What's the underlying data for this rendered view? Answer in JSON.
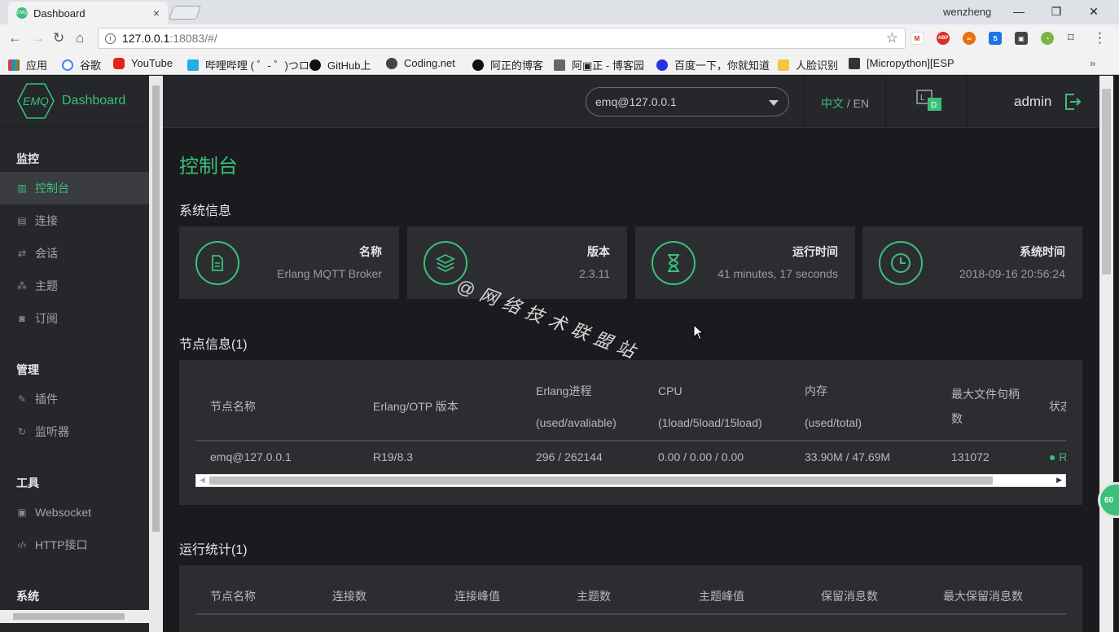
{
  "browser": {
    "tab_title": "Dashboard",
    "tab_favicon": "EMQ",
    "tab_close": "×",
    "user_name": "wenzheng",
    "window_controls": [
      "—",
      "❐",
      "✕"
    ],
    "url_host": "127.0.0.1",
    "url_path": ":18083/#/",
    "bookmarks": [
      "应用",
      "谷歌",
      "YouTube",
      "哔哩哔哩 ( ゜- ゜)つロ",
      "GitHub上",
      "Coding.net",
      "阿正的博客",
      "阿▣正 - 博客园",
      "百度一下，你就知道",
      "人脸识别",
      "[Micropython][ESP"
    ],
    "bookmarks_more": "»",
    "extensions": [
      "M",
      "ABP",
      "∞",
      "S",
      "▣",
      "◔"
    ]
  },
  "sidebar": {
    "logo_badge": "EMQ",
    "logo_text": "Dashboard",
    "sections": [
      {
        "title": "监控",
        "items": [
          "控制台",
          "连接",
          "会话",
          "主题",
          "订阅"
        ]
      },
      {
        "title": "管理",
        "items": [
          "插件",
          "监听器"
        ]
      },
      {
        "title": "工具",
        "items": [
          "Websocket",
          "HTTP接口"
        ]
      },
      {
        "title": "系统",
        "items": []
      }
    ],
    "active_item": "控制台"
  },
  "topbar": {
    "node": "emq@127.0.0.1",
    "lang_zh": "中文",
    "lang_sep": " / ",
    "lang_en": "EN",
    "ld_badge": "D",
    "user": "admin"
  },
  "page": {
    "title": "控制台",
    "system_info_title": "系统信息",
    "cards": [
      {
        "label": "名称",
        "value": "Erlang MQTT Broker",
        "icon": "document-icon"
      },
      {
        "label": "版本",
        "value": "2.3.11",
        "icon": "layers-icon"
      },
      {
        "label": "运行时间",
        "value": "41 minutes, 17 seconds",
        "icon": "hourglass-icon"
      },
      {
        "label": "系统时间",
        "value": "2018-09-16 20:56:24",
        "icon": "clock-icon"
      }
    ],
    "node_info_title": "节点信息(1)",
    "node_table": {
      "headers": [
        {
          "l1": "节点名称",
          "l2": ""
        },
        {
          "l1": "Erlang/OTP 版本",
          "l2": ""
        },
        {
          "l1": "Erlang进程",
          "l2": "(used/avaliable)"
        },
        {
          "l1": "CPU",
          "l2": "(1load/5load/15load)"
        },
        {
          "l1": "内存",
          "l2": "(used/total)"
        },
        {
          "l1": "最大文件句柄",
          "l2": "数"
        },
        {
          "l1": "状态",
          "l2": ""
        }
      ],
      "row": [
        "emq@127.0.0.1",
        "R19/8.3",
        "296 / 262144",
        "0.00 / 0.00 / 0.00",
        "33.90M / 47.69M",
        "131072",
        "Running"
      ]
    },
    "stats_title": "运行统计(1)",
    "stats_headers": [
      "节点名称",
      "连接数",
      "连接峰值",
      "主题数",
      "主题峰值",
      "保留消息数",
      "最大保留消息数"
    ],
    "watermark": "@网络技术联盟站",
    "float_badge": "60"
  },
  "colors": {
    "accent": "#3bbf7a",
    "sidebar_bg": "#26272b",
    "main_bg": "#1a1b1e",
    "card_bg": "#2c2d31"
  }
}
